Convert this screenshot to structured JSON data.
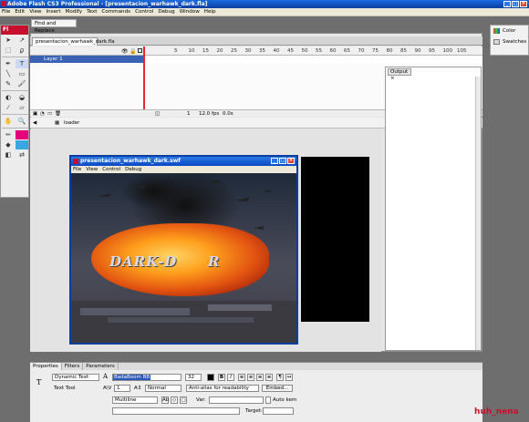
{
  "app": {
    "title": "Adobe Flash CS3 Professional - [presentacion_warhawk_dark.fla]",
    "logo": "Fl"
  },
  "menubar": [
    "File",
    "Edit",
    "View",
    "Insert",
    "Modify",
    "Text",
    "Commands",
    "Control",
    "Debug",
    "Window",
    "Help"
  ],
  "panels": {
    "find_tab": "Find and Replace",
    "color_label": "Color",
    "swatches_label": "Swatches",
    "output_tab": "Output"
  },
  "document": {
    "tab": "presentacion_warhawk_dark.fla",
    "layer": "Layer 1",
    "frame_numbers": [
      "5",
      "10",
      "15",
      "20",
      "25",
      "30",
      "35",
      "40",
      "45",
      "50",
      "55",
      "60",
      "65",
      "70",
      "75",
      "80",
      "85",
      "90",
      "95",
      "100",
      "105"
    ],
    "current_frame": "1",
    "fps": "12.0 fps",
    "time": "0.0s",
    "scene": "loader"
  },
  "swf_window": {
    "title": "presentacion_warhawk_dark.swf",
    "menu": [
      "File",
      "View",
      "Control",
      "Debug"
    ],
    "logo_text_left": "DARK-D",
    "logo_text_right": "R"
  },
  "properties": {
    "tabs": [
      "Properties",
      "Filters",
      "Parameters"
    ],
    "text_type": "Dynamic Text",
    "tool_name": "Text Tool",
    "font": "BadaBoom BB",
    "font_size": "32",
    "letter_spacing": "1",
    "position": "Normal",
    "anti_alias": "Anti-alias for readability",
    "embed_button": "Embed...",
    "line_type": "Multiline",
    "var_label": "Var:",
    "target_label": "Target:",
    "auto_kern": "Auto kern"
  },
  "watermark": "huh_nena",
  "colors": {
    "accent": "#c8102e",
    "titlebar": "#0a3fa0",
    "layer_selected": "#3a63b6"
  }
}
